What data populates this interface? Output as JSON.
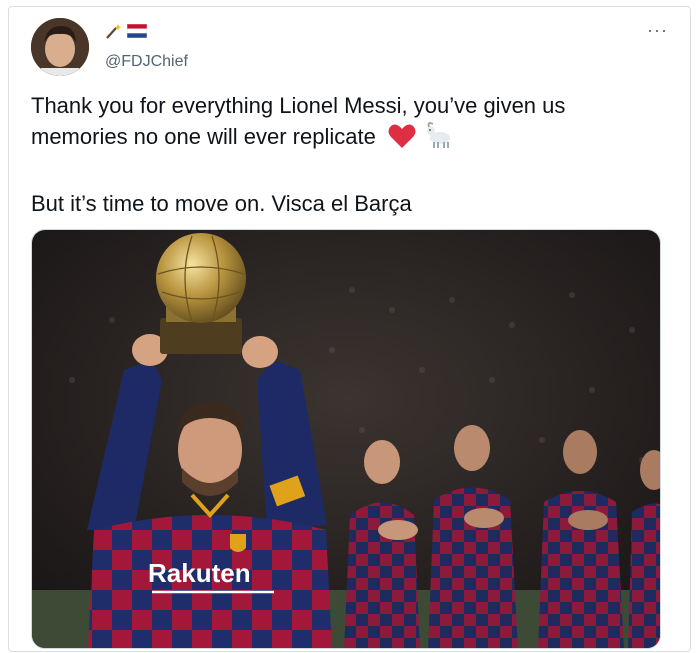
{
  "tweet": {
    "handle": "@FDJChief",
    "text_line1": "Thank you for everything Lionel Messi, you’ve given us",
    "text_line2": "memories no one will ever replicate",
    "text_line3": "But it’s time to move on. Visca el Barça",
    "emoji": [
      "red-heart",
      "goat"
    ],
    "name_icons": [
      "magic-wand-icon",
      "netherlands-flag-icon"
    ],
    "menu_label": "···"
  },
  "photo": {
    "sponsor_text": "Rakuten"
  }
}
